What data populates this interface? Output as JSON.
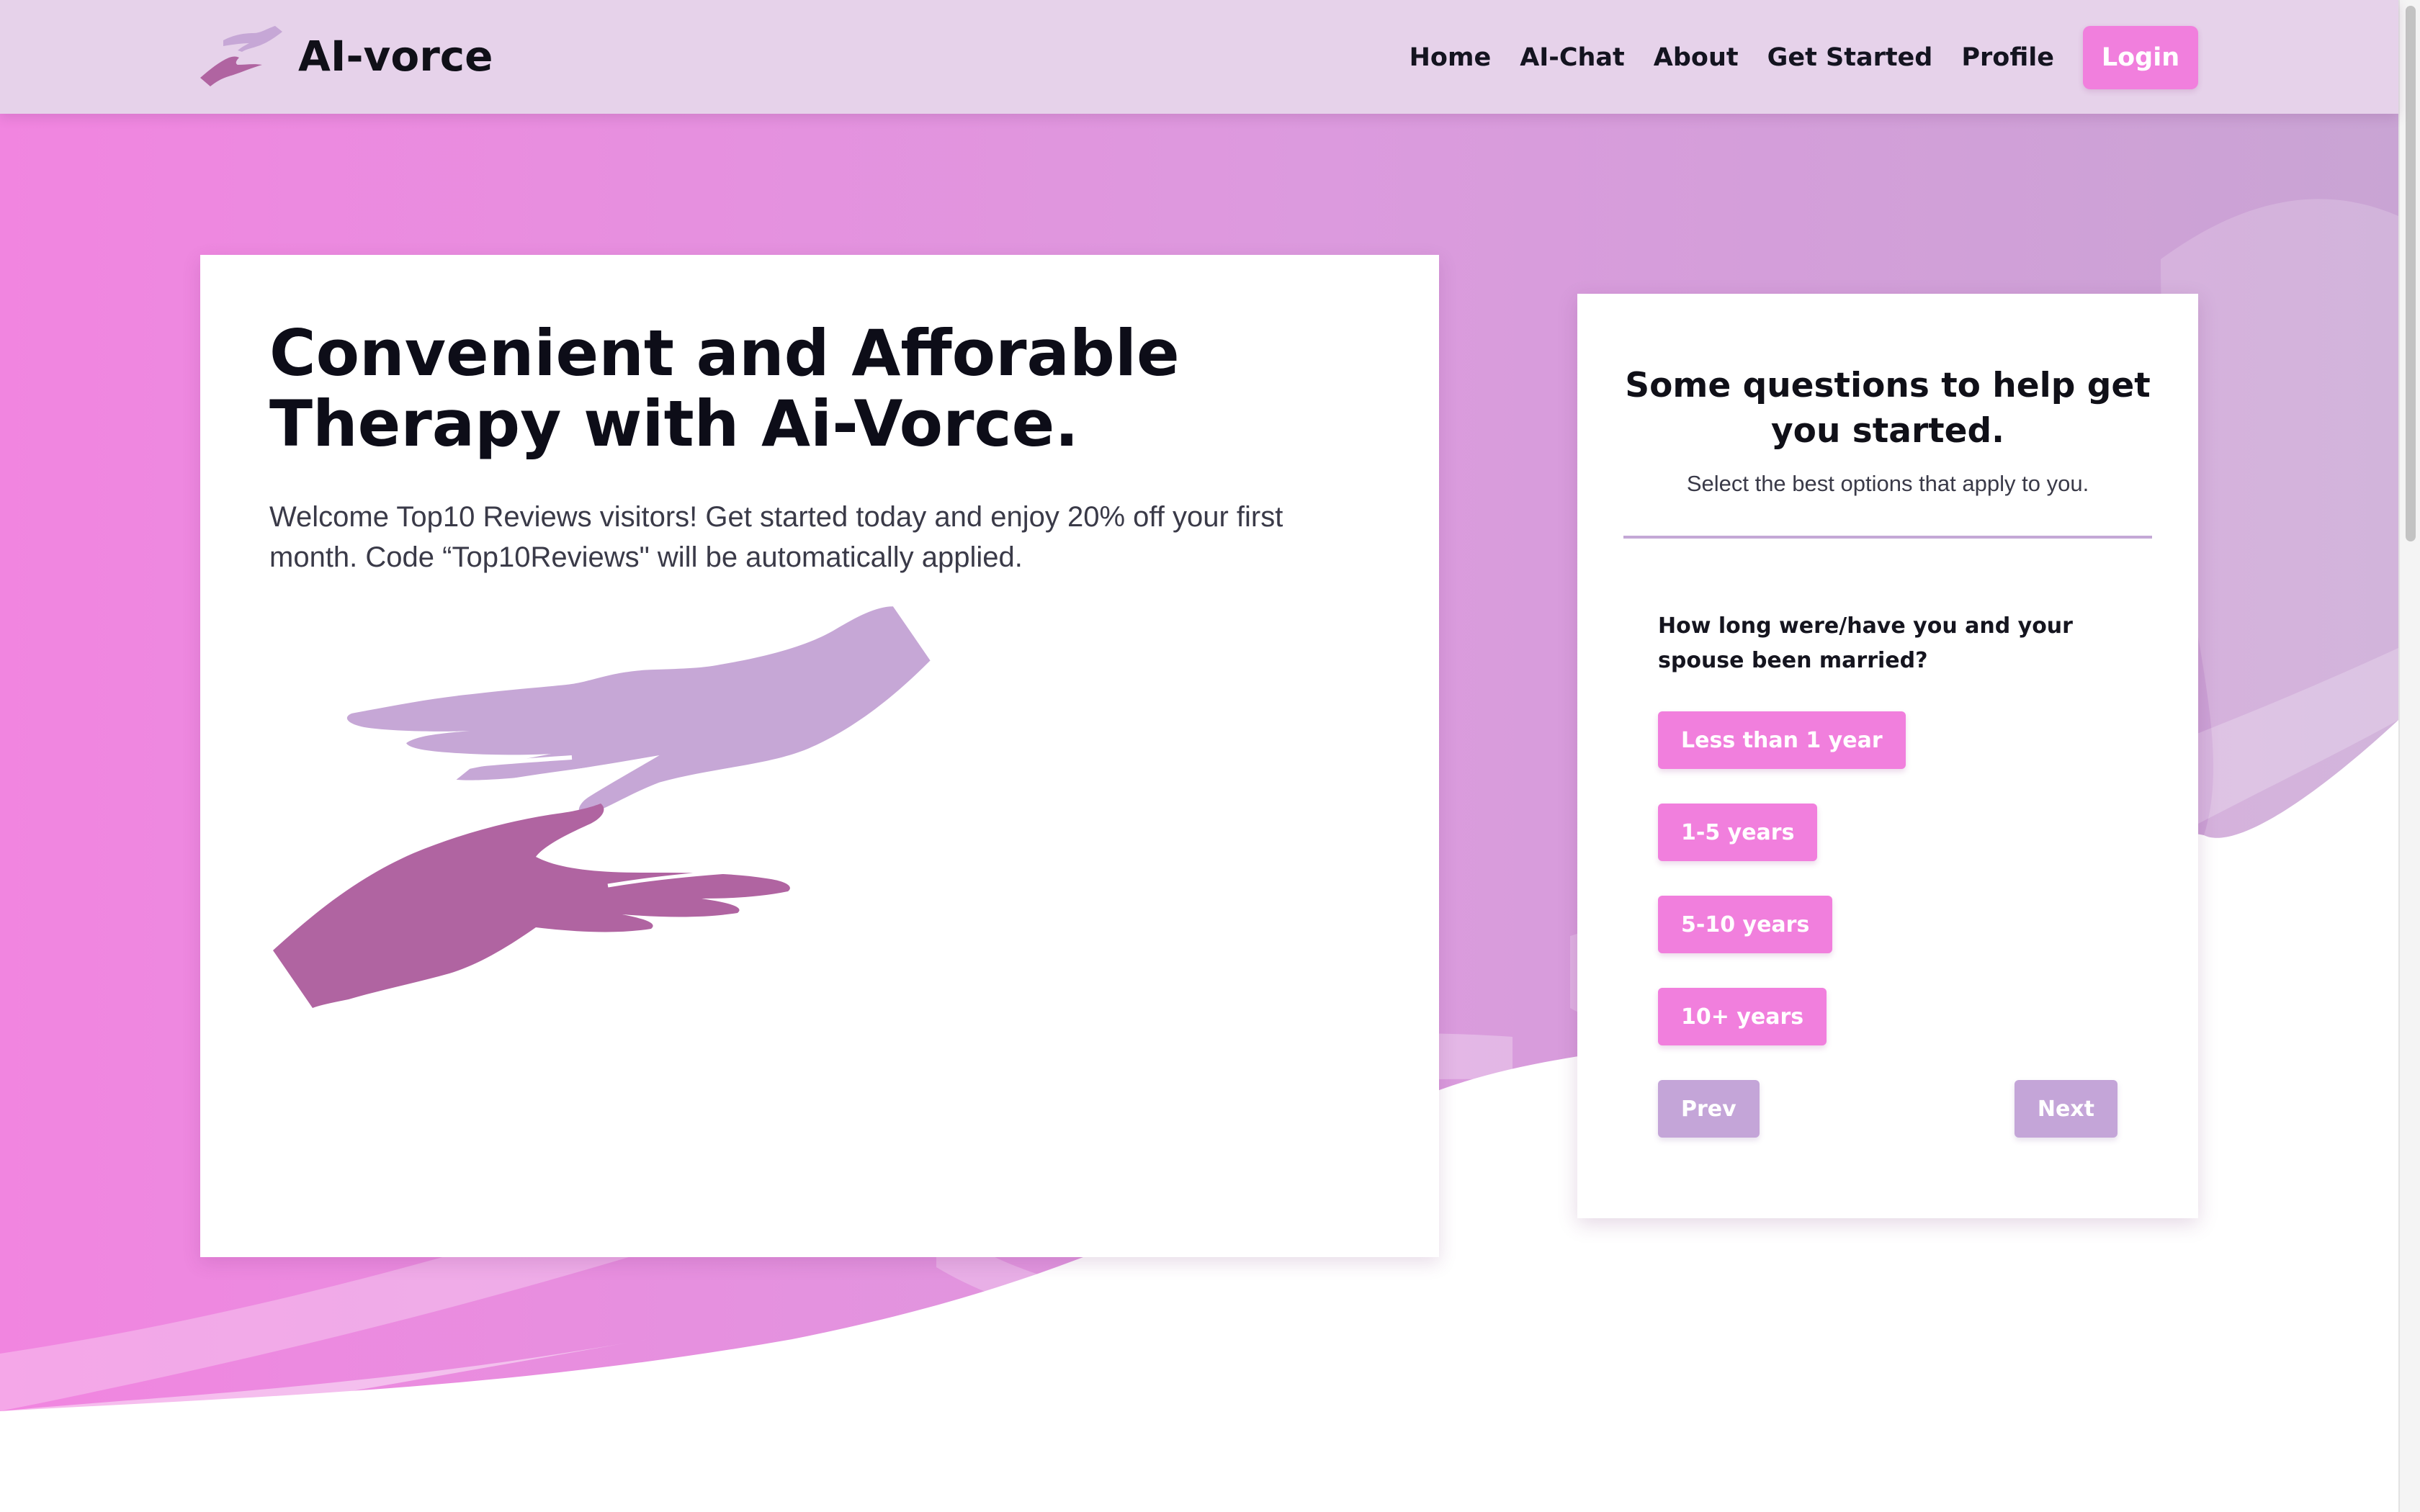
{
  "brand": {
    "name": "AI-vorce",
    "logo_icon": "reaching-hands-icon"
  },
  "nav": {
    "links": [
      "Home",
      "AI-Chat",
      "About",
      "Get Started",
      "Profile"
    ],
    "login_label": "Login"
  },
  "hero": {
    "headline": "Convenient and Afforable Therapy with Ai-Vorce.",
    "intro": "Welcome Top10 Reviews visitors! Get started today and enjoy 20% off your first month. Code “Top10Reviews\" will be automatically applied.",
    "illustration_icon": "reaching-hands-icon"
  },
  "quiz": {
    "title": "Some questions to help get you started.",
    "subtitle": "Select the best options that apply to you.",
    "question": "How long were/have you and your spouse been married?",
    "options": [
      "Less than 1 year",
      "1-5 years",
      "5-10 years",
      "10+ years"
    ],
    "prev_label": "Prev",
    "next_label": "Next"
  },
  "colors": {
    "accent_pink": "#f17fdd",
    "muted_purple": "#c4a5d8",
    "navbar_bg": "#e6d2ea",
    "hand_light": "#c6a7d6",
    "hand_dark": "#b064a1"
  }
}
